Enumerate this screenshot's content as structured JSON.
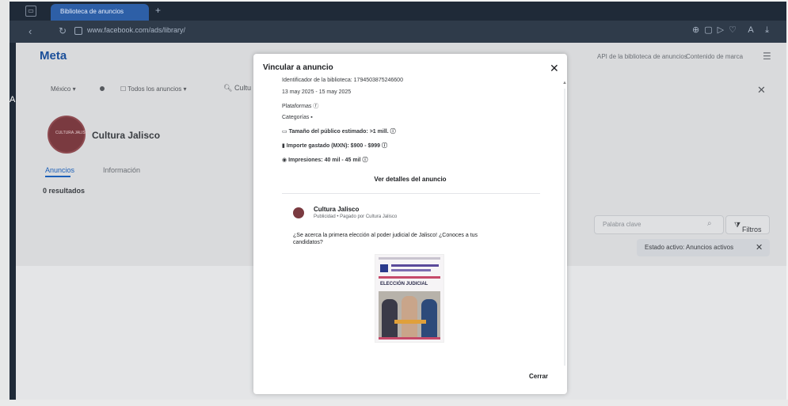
{
  "browser": {
    "tab_title": "Biblioteca de anuncios",
    "url": "www.facebook.com/ads/library/"
  },
  "page": {
    "logo": "Meta",
    "top_links": [
      "API de la biblioteca de anuncios",
      "Contenido de marca"
    ],
    "filters": {
      "country": "México ▾",
      "ad_type": "Todos los anuncios ▾",
      "search": "Cultu"
    },
    "page_name": "Cultura Jalisco",
    "avatar_label": "CULTURA JALISCO",
    "tabs": [
      "Anuncios",
      "Información"
    ],
    "results": "0 resultados",
    "search_placeholder": "Palabra clave",
    "filters_button": "Filtros",
    "status_chip": "Estado activo: Anuncios activos"
  },
  "modal": {
    "title": "Vincular a anuncio",
    "lines": {
      "library_id": "Identificador de la biblioteca: 1794503875246600",
      "dates": "13 may 2025 - 15 may 2025",
      "platforms": "Plataformas",
      "categories": "Categorías",
      "audience": "Tamaño del público estimado: >1 mill.",
      "amount": "Importe gastado (MXN): $900 - $999",
      "impressions": "Impresiones: 40 mil - 45 mil"
    },
    "details_link": "Ver detalles del anuncio",
    "advertiser": {
      "name": "Cultura Jalisco",
      "sub": "Publicidad • Pagado por Cultura Jalisco"
    },
    "ad_text": "¿Se acerca la primera elección al poder judicial de Jalisco! ¿Conoces a tus candidatos?",
    "image_caption": "ELECCIÓN JUDICIAL",
    "close_label": "Cerrar"
  }
}
